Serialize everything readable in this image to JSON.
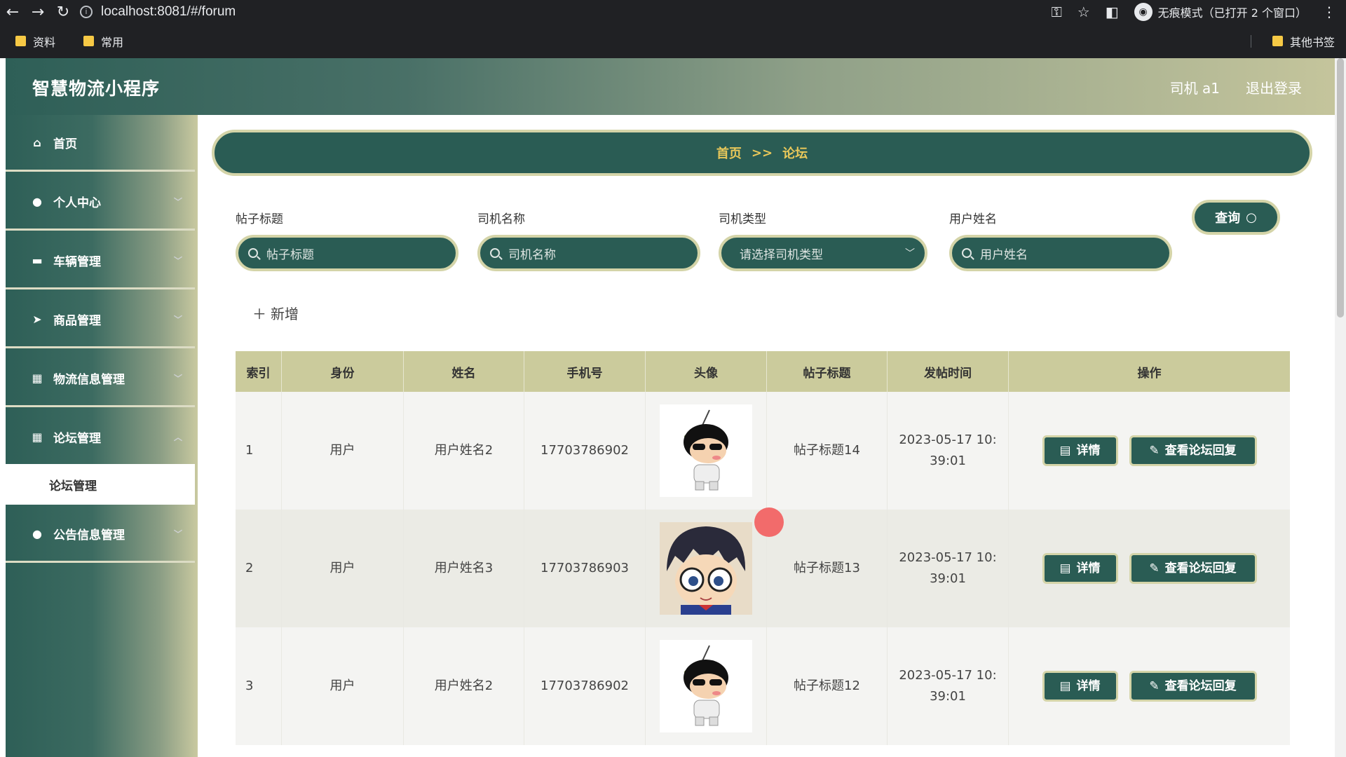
{
  "browser": {
    "url": "localhost:8081/#/forum",
    "incognito_label": "无痕模式（已打开 2 个窗口）",
    "bookmarks": [
      "资料",
      "常用"
    ],
    "other_bookmarks": "其他书签"
  },
  "header": {
    "app_title": "智慧物流小程序",
    "user": "司机 a1",
    "logout": "退出登录"
  },
  "sidebar": {
    "items": [
      {
        "label": "首页",
        "icon": "home-icon"
      },
      {
        "label": "个人中心",
        "icon": "user-icon"
      },
      {
        "label": "车辆管理",
        "icon": "briefcase-icon"
      },
      {
        "label": "商品管理",
        "icon": "send-icon"
      },
      {
        "label": "物流信息管理",
        "icon": "grid-icon"
      },
      {
        "label": "论坛管理",
        "icon": "grid-icon"
      },
      {
        "label": "公告信息管理",
        "icon": "user-icon"
      }
    ],
    "active_sub": "论坛管理"
  },
  "breadcrumb": {
    "home": "首页",
    "sep": ">>",
    "current": "论坛"
  },
  "filters": {
    "post_title": {
      "label": "帖子标题",
      "placeholder": "帖子标题"
    },
    "driver_name": {
      "label": "司机名称",
      "placeholder": "司机名称"
    },
    "driver_type": {
      "label": "司机类型",
      "placeholder": "请选择司机类型"
    },
    "user_name": {
      "label": "用户姓名",
      "placeholder": "用户姓名"
    },
    "query": "查询"
  },
  "add_label": "新增",
  "table": {
    "headers": [
      "索引",
      "身份",
      "姓名",
      "手机号",
      "头像",
      "帖子标题",
      "发帖时间",
      "操作"
    ],
    "rows": [
      {
        "index": "1",
        "role": "用户",
        "name": "用户姓名2",
        "phone": "17703786902",
        "avatar": "shinchan",
        "title": "帖子标题14",
        "time_line1": "2023-05-17 10:",
        "time_line2": "39:01"
      },
      {
        "index": "2",
        "role": "用户",
        "name": "用户姓名3",
        "phone": "17703786903",
        "avatar": "conan",
        "title": "帖子标题13",
        "time_line1": "2023-05-17 10:",
        "time_line2": "39:01"
      },
      {
        "index": "3",
        "role": "用户",
        "name": "用户姓名2",
        "phone": "17703786902",
        "avatar": "shinchan",
        "title": "帖子标题12",
        "time_line1": "2023-05-17 10:",
        "time_line2": "39:01"
      }
    ],
    "detail_label": "详情",
    "reply_label": "查看论坛回复"
  }
}
